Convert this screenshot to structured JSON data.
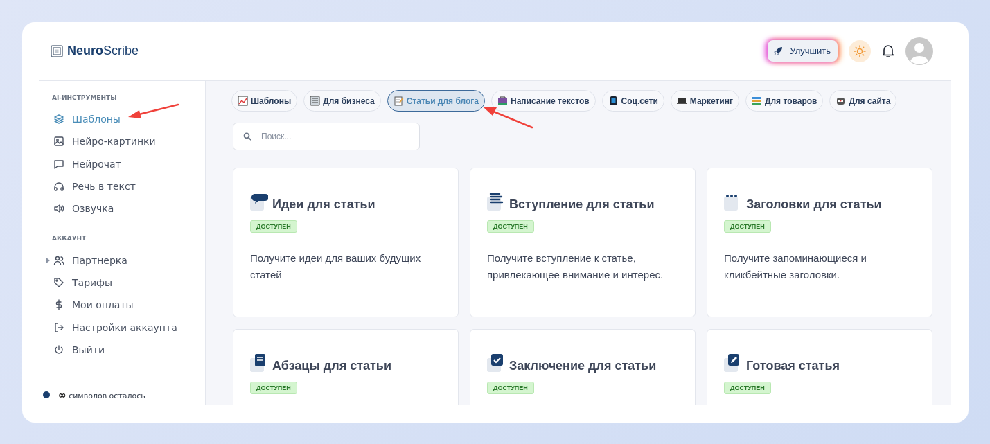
{
  "logo": {
    "bold": "Neuro",
    "light": "Scribe"
  },
  "header": {
    "upgrade": "Улучшить"
  },
  "sidebar": {
    "sections": [
      {
        "title": "AI-ИНСТРУМЕНТЫ",
        "items": [
          {
            "label": "Шаблоны",
            "kind": "layers",
            "selected": true,
            "expandable": false
          },
          {
            "label": "Нейро-картинки",
            "kind": "image",
            "selected": false,
            "expandable": false
          },
          {
            "label": "Нейрочат",
            "kind": "chat",
            "selected": false,
            "expandable": false
          },
          {
            "label": "Речь в текст",
            "kind": "headphones",
            "selected": false,
            "expandable": false
          },
          {
            "label": "Озвучка",
            "kind": "speaker",
            "selected": false,
            "expandable": false
          }
        ]
      },
      {
        "title": "АККАУНТ",
        "items": [
          {
            "label": "Партнерка",
            "kind": "users",
            "selected": false,
            "expandable": true
          },
          {
            "label": "Тарифы",
            "kind": "tag",
            "selected": false,
            "expandable": false
          },
          {
            "label": "Мои оплаты",
            "kind": "dollar",
            "selected": false,
            "expandable": false
          },
          {
            "label": "Настройки аккаунта",
            "kind": "logout",
            "selected": false,
            "expandable": false
          },
          {
            "label": "Выйти",
            "kind": "power",
            "selected": false,
            "expandable": false
          }
        ]
      }
    ],
    "balance": {
      "amount": "∞",
      "label": "символов осталось"
    }
  },
  "chips": [
    {
      "label": "Шаблоны",
      "kind": "chart",
      "selected": false
    },
    {
      "label": "Для бизнеса",
      "kind": "ledger",
      "selected": false
    },
    {
      "label": "Статьи для блога",
      "kind": "memo",
      "selected": true
    },
    {
      "label": "Написание текстов",
      "kind": "bag",
      "selected": false
    },
    {
      "label": "Соц.сети",
      "kind": "phone",
      "selected": false
    },
    {
      "label": "Маркетинг",
      "kind": "laptop",
      "selected": false
    },
    {
      "label": "Для товаров",
      "kind": "books",
      "selected": false
    },
    {
      "label": "Для сайта",
      "kind": "robot",
      "selected": false
    }
  ],
  "search": {
    "placeholder": "Поиск..."
  },
  "cards": [
    {
      "title": "Идеи для статьи",
      "kind": "bubble",
      "badge": "ДОСТУПЕН",
      "description": "Получите идеи для ваших будущих статей"
    },
    {
      "title": "Вступление для статьи",
      "kind": "lines",
      "badge": "ДОСТУПЕН",
      "description": "Получите вступление к статье, привлекающее внимание и интерес."
    },
    {
      "title": "Заголовки для статьи",
      "kind": "dots",
      "badge": "ДОСТУПЕН",
      "description": "Получите запоминающиеся и кликбейтные заголовки."
    },
    {
      "title": "Абзацы для статьи",
      "kind": "book",
      "badge": "ДОСТУПЕН"
    },
    {
      "title": "Заключение для статьи",
      "kind": "check",
      "badge": "ДОСТУПЕН"
    },
    {
      "title": "Готовая статья",
      "kind": "pen",
      "badge": "ДОСТУПЕН"
    }
  ]
}
